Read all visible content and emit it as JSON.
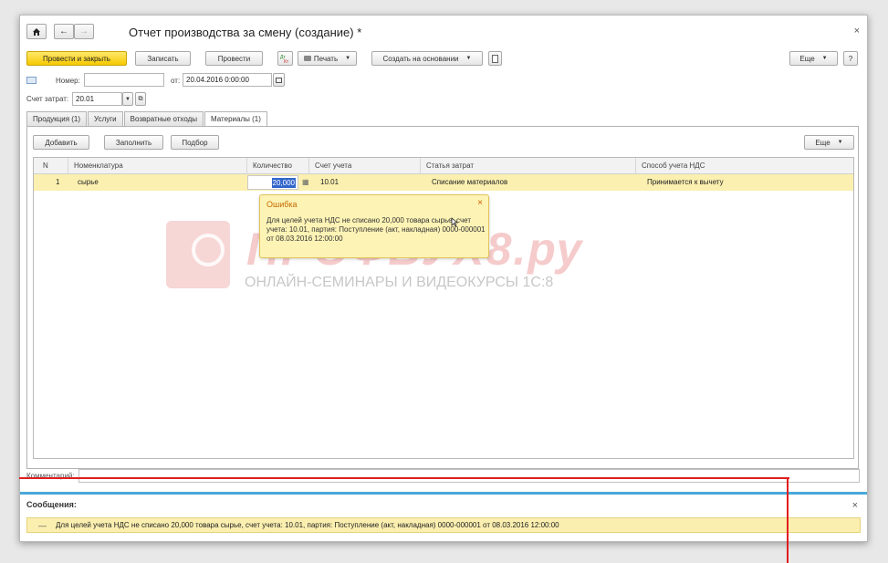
{
  "window": {
    "title": "Отчет производства за смену (создание) *",
    "close_glyph": "×"
  },
  "nav": {
    "home_icon": "home-icon",
    "back_glyph": "←",
    "forward_glyph": "→"
  },
  "toolbar": {
    "post_close_label": "Провести и закрыть",
    "save_label": "Записать",
    "post_label": "Провести",
    "print_label": "Печать",
    "create_based_label": "Создать на основании",
    "more_label": "Еще",
    "help_label": "?"
  },
  "header_fields": {
    "number_label": "Номер:",
    "number_value": "",
    "date_label": "от:",
    "date_value": "20.04.2016  0:00:00",
    "cost_account_label": "Счет затрат:",
    "cost_account_value": "20.01"
  },
  "tabs": [
    {
      "label": "Продукция (1)"
    },
    {
      "label": "Услуги"
    },
    {
      "label": "Возвратные отходы"
    },
    {
      "label": "Материалы (1)"
    }
  ],
  "table_toolbar": {
    "add_label": "Добавить",
    "fill_label": "Заполнить",
    "pick_label": "Подбор",
    "more_label": "Еще"
  },
  "table": {
    "columns": [
      "N",
      "Номенклатура",
      "Количество",
      "Счет учета",
      "Статья затрат",
      "Способ учета НДС"
    ],
    "rows": [
      {
        "n": "1",
        "item": "сырье",
        "qty": "20,000",
        "account": "10.01",
        "cost_item": "Списание материалов",
        "vat_method": "Принимается к вычету"
      }
    ]
  },
  "tooltip": {
    "title": "Ошибка",
    "close_glyph": "×",
    "text": "Для целей учета НДС не списано 20,000 товара сырье, счет учета: 10.01, партия: Поступление (акт, накладная) 0000-000001 от 08.03.2016 12:00:00"
  },
  "watermark": {
    "title": "ПРОФБУХ8.ру",
    "subtitle": "ОНЛАЙН-СЕМИНАРЫ И ВИДЕОКУРСЫ 1С:8"
  },
  "comment": {
    "label": "Комментарий:",
    "value": ""
  },
  "messages": {
    "title": "Сообщения:",
    "close_glyph": "×",
    "items": [
      {
        "dash": "—",
        "text": "Для целей учета НДС не списано 20,000 товара сырье, счет учета: 10.01, партия: Поступление (акт, накладная) 0000-000001 от 08.03.2016 12:00:00"
      }
    ]
  },
  "colors": {
    "primary_button": "#f6c900",
    "selected_row": "#fbf0b0",
    "message_bar": "#4aa8d8",
    "annotation_line": "#e11d1d",
    "watermark": "#dc4646"
  }
}
